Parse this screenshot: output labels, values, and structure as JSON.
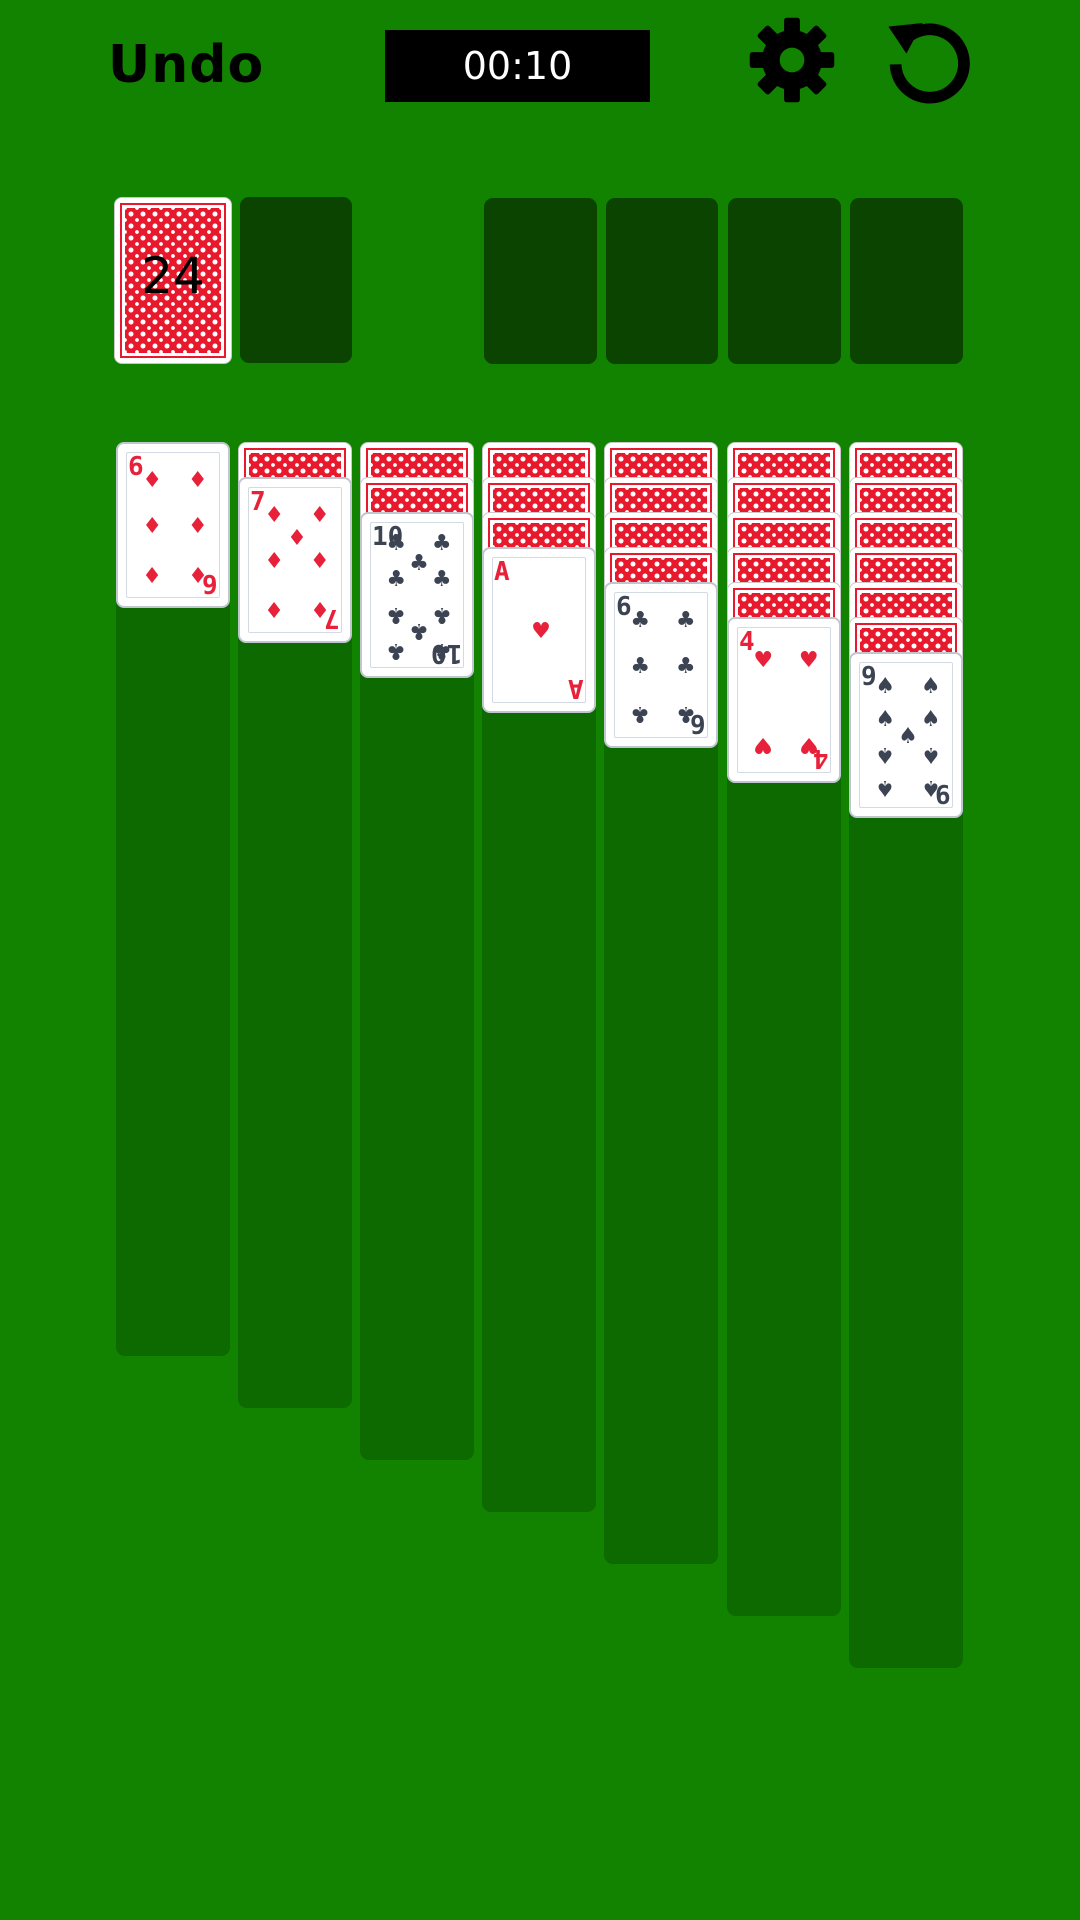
{
  "toolbar": {
    "undo_label": "Undo",
    "timer": "00:10",
    "settings_icon": "gear-icon",
    "restart_icon": "restart-icon"
  },
  "stock": {
    "count": "24"
  },
  "colors": {
    "felt": "#118300",
    "slot": "#0a4400",
    "column": "#0c6a00",
    "red_suit": "#e8213b",
    "black_suit": "#3c4352"
  },
  "tableau": [
    {
      "face_down": 0,
      "face_up": [
        {
          "rank": "6",
          "suit": "diamonds",
          "symbol": "♦",
          "color": "red"
        }
      ]
    },
    {
      "face_down": 1,
      "face_up": [
        {
          "rank": "7",
          "suit": "diamonds",
          "symbol": "♦",
          "color": "red"
        }
      ]
    },
    {
      "face_down": 2,
      "face_up": [
        {
          "rank": "10",
          "suit": "clubs",
          "symbol": "♣",
          "color": "black"
        }
      ]
    },
    {
      "face_down": 3,
      "face_up": [
        {
          "rank": "A",
          "suit": "hearts",
          "symbol": "♥",
          "color": "red"
        }
      ]
    },
    {
      "face_down": 4,
      "face_up": [
        {
          "rank": "6",
          "suit": "clubs",
          "symbol": "♣",
          "color": "black"
        }
      ]
    },
    {
      "face_down": 5,
      "face_up": [
        {
          "rank": "4",
          "suit": "hearts",
          "symbol": "♥",
          "color": "red"
        }
      ]
    },
    {
      "face_down": 6,
      "face_up": [
        {
          "rank": "9",
          "suit": "spades",
          "symbol": "♠",
          "color": "black"
        }
      ]
    }
  ]
}
